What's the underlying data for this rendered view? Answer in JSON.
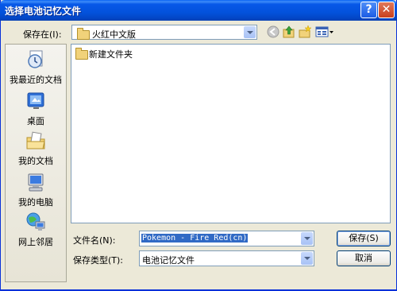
{
  "dialog": {
    "title": "选择电池记忆文件"
  },
  "save_in": {
    "label": "保存在(I):",
    "value": "火红中文版"
  },
  "places": [
    {
      "label": "我最近的文档",
      "icon": "recent-documents-icon"
    },
    {
      "label": "桌面",
      "icon": "desktop-icon"
    },
    {
      "label": "我的文档",
      "icon": "my-documents-icon"
    },
    {
      "label": "我的电脑",
      "icon": "my-computer-icon"
    },
    {
      "label": "网上邻居",
      "icon": "network-places-icon"
    }
  ],
  "files": [
    {
      "name": "新建文件夹",
      "icon": "folder-icon"
    }
  ],
  "filename": {
    "label": "文件名(N):",
    "value": "Pokemon - Fire Red(cn)"
  },
  "filetype": {
    "label": "保存类型(T):",
    "value": "电池记忆文件"
  },
  "buttons": {
    "save": "保存(S)",
    "cancel": "取消",
    "help": "?",
    "close": "✕"
  },
  "colors": {
    "titlebar": "#0352dc",
    "face": "#ece9d8",
    "selection": "#316ac5"
  }
}
